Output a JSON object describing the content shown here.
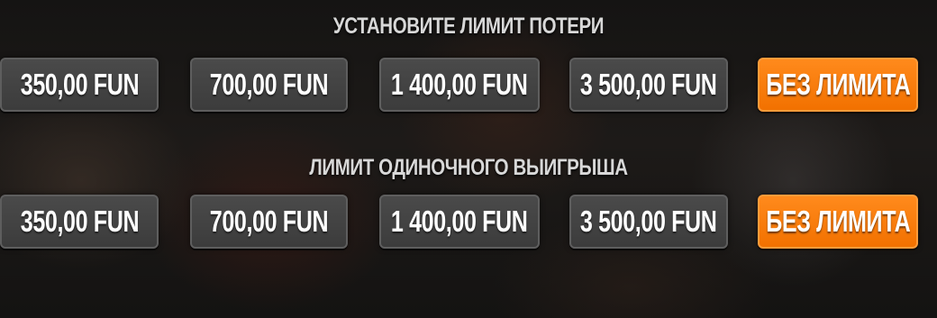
{
  "loss_limit": {
    "title": "УСТАНОВИТЕ ЛИМИТ ПОТЕРИ",
    "options": [
      {
        "label": "350,00 FUN",
        "selected": false
      },
      {
        "label": "700,00 FUN",
        "selected": false
      },
      {
        "label": "1 400,00 FUN",
        "selected": false
      },
      {
        "label": "3 500,00 FUN",
        "selected": false
      },
      {
        "label": "БЕЗ ЛИМИТА",
        "selected": true
      }
    ]
  },
  "single_win_limit": {
    "title": "ЛИМИТ ОДИНОЧНОГО ВЫИГРЫША",
    "options": [
      {
        "label": "350,00 FUN",
        "selected": false
      },
      {
        "label": "700,00 FUN",
        "selected": false
      },
      {
        "label": "1 400,00 FUN",
        "selected": false
      },
      {
        "label": "3 500,00 FUN",
        "selected": false
      },
      {
        "label": "БЕЗ ЛИМИТА",
        "selected": true
      }
    ]
  },
  "colors": {
    "selected_button": "#f27100",
    "unselected_button": "#3c3c3c",
    "title_text": "#d8d8d8",
    "button_text": "#ffffff"
  }
}
